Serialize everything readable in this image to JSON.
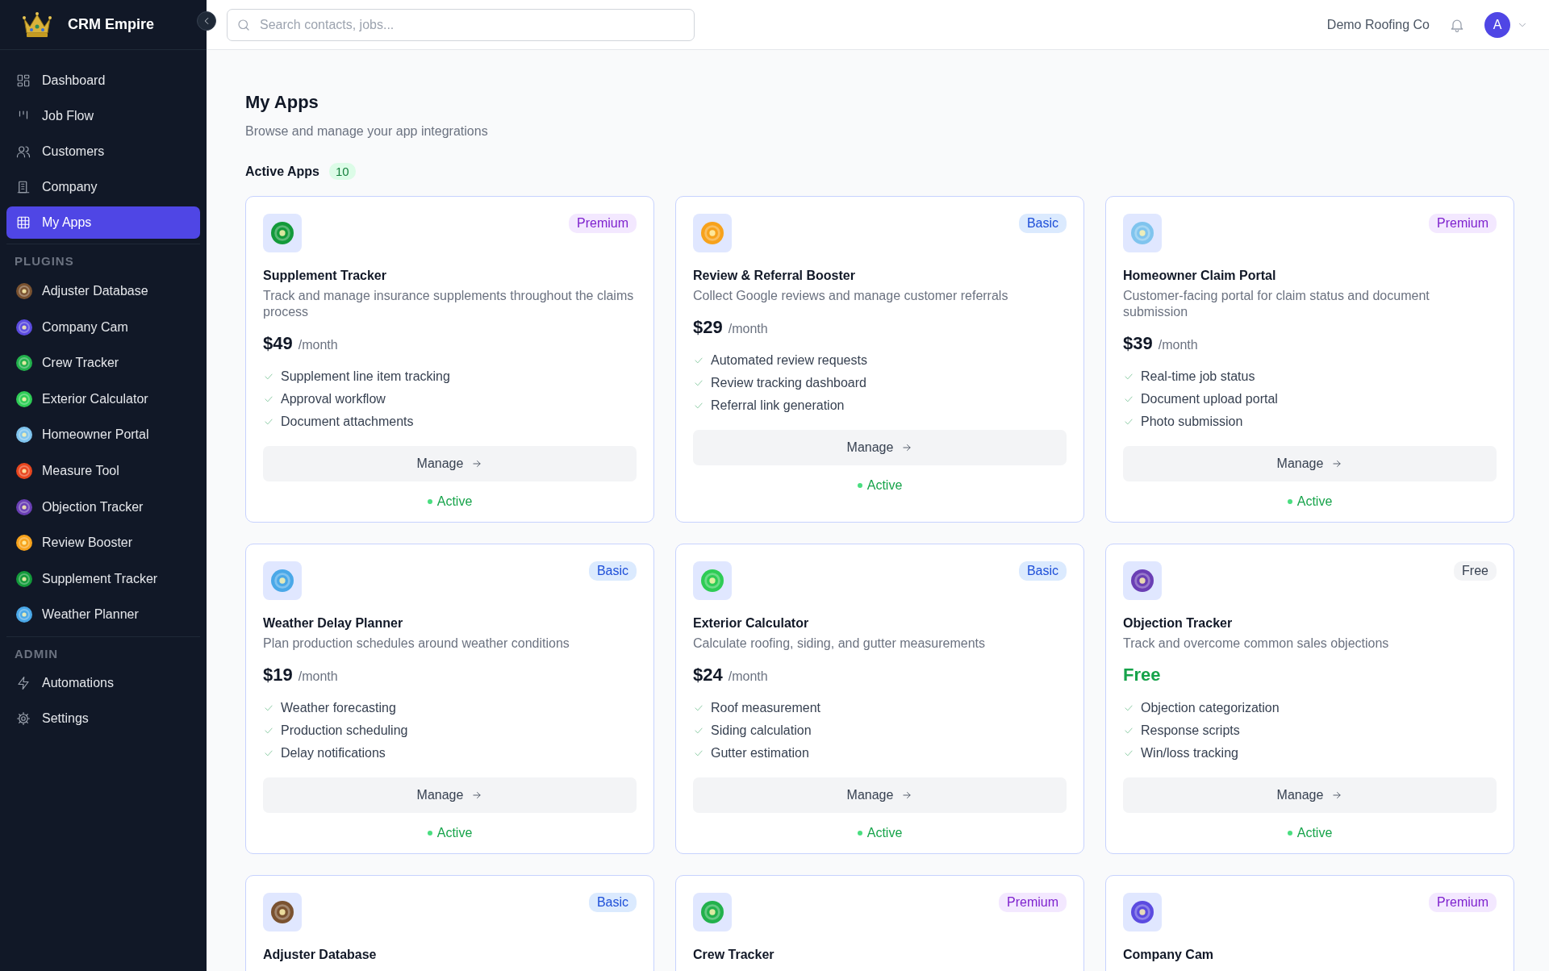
{
  "brand": {
    "name": "CRM Empire"
  },
  "nav": [
    {
      "label": "Dashboard",
      "kind": "dashboard",
      "selected": false
    },
    {
      "label": "Job Flow",
      "kind": "flow",
      "selected": false
    },
    {
      "label": "Customers",
      "kind": "users",
      "selected": false
    },
    {
      "label": "Company",
      "kind": "building",
      "selected": false
    },
    {
      "label": "My Apps",
      "kind": "grid",
      "selected": true
    }
  ],
  "plugins": {
    "heading": "PLUGINS",
    "items": [
      {
        "label": "Adjuster Database",
        "color": "#7a5230"
      },
      {
        "label": "Company Cam",
        "color": "#5b4be0"
      },
      {
        "label": "Crew Tracker",
        "color": "#22b14c"
      },
      {
        "label": "Exterior Calculator",
        "color": "#2ecc55"
      },
      {
        "label": "Homeowner Portal",
        "color": "#7fc4ee"
      },
      {
        "label": "Measure Tool",
        "color": "#e8461e"
      },
      {
        "label": "Objection Tracker",
        "color": "#6a3fb5"
      },
      {
        "label": "Review Booster",
        "color": "#f7a21b"
      },
      {
        "label": "Supplement Tracker",
        "color": "#139a3a"
      },
      {
        "label": "Weather Planner",
        "color": "#4aa8e8"
      }
    ]
  },
  "admin": {
    "heading": "ADMIN",
    "items": [
      {
        "label": "Automations",
        "kind": "bolt"
      },
      {
        "label": "Settings",
        "kind": "gear"
      }
    ]
  },
  "topbar": {
    "search": {
      "placeholder": "Search contacts, jobs..."
    },
    "company": "Demo Roofing Co",
    "avatar": "A"
  },
  "page": {
    "title": "My Apps",
    "subtitle": "Browse and manage your app integrations"
  },
  "section": {
    "title": "Active Apps",
    "count": "10"
  },
  "apps": [
    {
      "name": "Supplement Tracker",
      "color": "#139a3a",
      "tier": {
        "label": "Premium",
        "kind": "premium"
      },
      "description": "Track and manage insurance supplements throughout the claims process",
      "price": "$49",
      "period": "/month",
      "features": [
        "Supplement line item tracking",
        "Approval workflow",
        "Document attachments"
      ],
      "action": "Manage",
      "status": "Active"
    },
    {
      "name": "Review & Referral Booster",
      "color": "#f7a21b",
      "tier": {
        "label": "Basic",
        "kind": "basic"
      },
      "description": "Collect Google reviews and manage customer referrals",
      "price": "$29",
      "period": "/month",
      "features": [
        "Automated review requests",
        "Review tracking dashboard",
        "Referral link generation"
      ],
      "action": "Manage",
      "status": "Active"
    },
    {
      "name": "Homeowner Claim Portal",
      "color": "#7fc4ee",
      "tier": {
        "label": "Premium",
        "kind": "premium"
      },
      "description": "Customer-facing portal for claim status and document submission",
      "price": "$39",
      "period": "/month",
      "features": [
        "Real-time job status",
        "Document upload portal",
        "Photo submission"
      ],
      "action": "Manage",
      "status": "Active"
    },
    {
      "name": "Weather Delay Planner",
      "color": "#4aa8e8",
      "tier": {
        "label": "Basic",
        "kind": "basic"
      },
      "description": "Plan production schedules around weather conditions",
      "price": "$19",
      "period": "/month",
      "features": [
        "Weather forecasting",
        "Production scheduling",
        "Delay notifications"
      ],
      "action": "Manage",
      "status": "Active"
    },
    {
      "name": "Exterior Calculator",
      "color": "#2ecc55",
      "tier": {
        "label": "Basic",
        "kind": "basic"
      },
      "description": "Calculate roofing, siding, and gutter measurements",
      "price": "$24",
      "period": "/month",
      "features": [
        "Roof measurement",
        "Siding calculation",
        "Gutter estimation"
      ],
      "action": "Manage",
      "status": "Active"
    },
    {
      "name": "Objection Tracker",
      "color": "#6a3fb5",
      "tier": {
        "label": "Free",
        "kind": "free"
      },
      "description": "Track and overcome common sales objections",
      "price": "Free",
      "features": [
        "Objection categorization",
        "Response scripts",
        "Win/loss tracking"
      ],
      "action": "Manage",
      "status": "Active"
    },
    {
      "name": "Adjuster Database",
      "color": "#7a5230",
      "tier": {
        "label": "Basic",
        "kind": "basic"
      }
    },
    {
      "name": "Crew Tracker",
      "color": "#22b14c",
      "tier": {
        "label": "Premium",
        "kind": "premium"
      }
    },
    {
      "name": "Company Cam",
      "color": "#5b4be0",
      "tier": {
        "label": "Premium",
        "kind": "premium"
      }
    }
  ]
}
